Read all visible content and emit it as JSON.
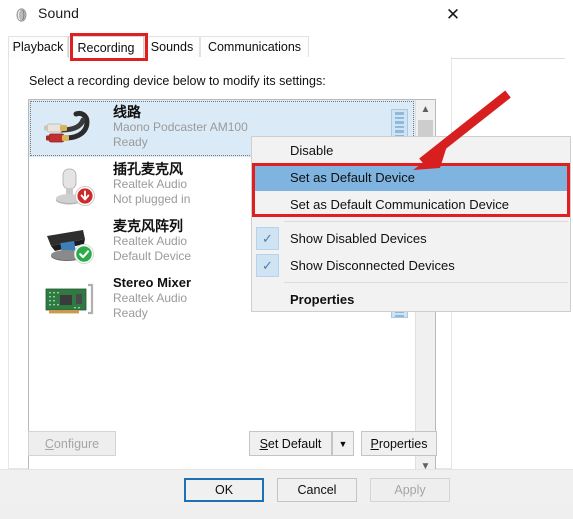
{
  "window": {
    "title": "Sound",
    "app_icon": "speaker-icon",
    "close_label": "✕"
  },
  "tabs": [
    {
      "label": "Playback",
      "active": false
    },
    {
      "label": "Recording",
      "active": true
    },
    {
      "label": "Sounds",
      "active": false
    },
    {
      "label": "Communications",
      "active": false
    }
  ],
  "panel": {
    "instruction": "Select a recording device below to modify its settings:"
  },
  "devices": [
    {
      "name": "线路",
      "driver": "Maono Podcaster AM100",
      "status": "Ready",
      "icon": "rca-cable-icon",
      "selected": true,
      "badge": "none",
      "meter_segments": 4
    },
    {
      "name": "插孔麦克风",
      "driver": "Realtek Audio",
      "status": "Not plugged in",
      "icon": "microphone-icon",
      "selected": false,
      "badge": "down-arrow-badge",
      "meter_segments": 0
    },
    {
      "name": "麦克风阵列",
      "driver": "Realtek Audio",
      "status": "Default Device",
      "icon": "microphone-array-icon",
      "selected": false,
      "badge": "green-check-badge",
      "meter_segments": 0
    },
    {
      "name": "Stereo Mixer",
      "driver": "Realtek Audio",
      "status": "Ready",
      "icon": "sound-card-icon",
      "selected": false,
      "badge": "none",
      "meter_segments": 4
    }
  ],
  "scrollbar": {
    "up_icon": "chevron-up-icon",
    "down_icon": "chevron-down-icon"
  },
  "context_menu": {
    "items": [
      {
        "label": "Disable",
        "type": "item",
        "highlighted": false,
        "checked": false,
        "bold": false
      },
      {
        "label": "Set as Default Device",
        "type": "item",
        "highlighted": true,
        "checked": false,
        "bold": false
      },
      {
        "label": "Set as Default Communication Device",
        "type": "item",
        "highlighted": false,
        "checked": false,
        "bold": false
      },
      {
        "label": "Show Disabled Devices",
        "type": "item",
        "highlighted": false,
        "checked": true,
        "bold": false
      },
      {
        "label": "Show Disconnected Devices",
        "type": "item",
        "highlighted": false,
        "checked": true,
        "bold": false
      },
      {
        "label": "Properties",
        "type": "item",
        "highlighted": false,
        "checked": false,
        "bold": true
      }
    ],
    "check_glyph": "✓"
  },
  "panel_buttons": {
    "configure": {
      "label": "Configure",
      "accel": "C",
      "disabled": true
    },
    "set_default": {
      "label": "Set Default",
      "accel": "S",
      "disabled": false
    },
    "set_default_arrow": "▼",
    "properties": {
      "label": "Properties",
      "accel": "P",
      "disabled": false
    }
  },
  "footer_buttons": {
    "ok": {
      "label": "OK",
      "default": true,
      "disabled": false
    },
    "cancel": {
      "label": "Cancel",
      "default": false,
      "disabled": false
    },
    "apply": {
      "label": "Apply",
      "default": false,
      "disabled": true
    }
  },
  "annotations": {
    "color": "#e02020",
    "highlight_tab": "Recording",
    "highlight_menu_items": [
      "Set as Default Device",
      "Set as Default Communication Device"
    ],
    "arrow": "points to Set as Default Device"
  },
  "colors": {
    "annotation_red": "#e02020",
    "menu_highlight_blue": "#7fb4e0",
    "selection_blue": "#dbeaf7",
    "default_button_border": "#1f6fb4",
    "green_badge": "#2bab4a",
    "red_badge": "#cf2a2a"
  }
}
